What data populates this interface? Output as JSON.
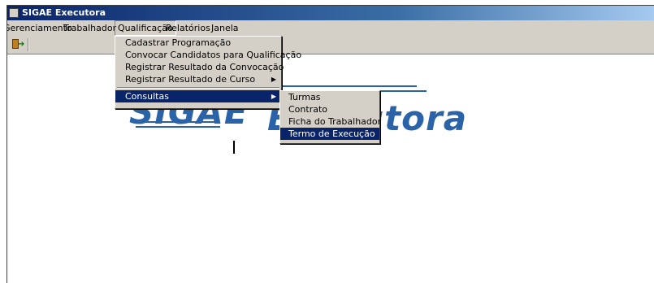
{
  "window": {
    "title": "SIGAE Executora"
  },
  "menubar": {
    "items": [
      {
        "label": "Gerenciamento"
      },
      {
        "label": "Trabalhador"
      },
      {
        "label": "Qualificação"
      },
      {
        "label": "Relatórios"
      },
      {
        "label": "Janela"
      }
    ]
  },
  "qualificacao_menu": {
    "items": [
      {
        "label": "Cadastrar Programação"
      },
      {
        "label": "Convocar Candidatos para Qualificação"
      },
      {
        "label": "Registrar Resultado da Convocação"
      },
      {
        "label": "Registrar Resultado de Curso",
        "arrow": "▶"
      },
      {
        "label": "Consultas",
        "arrow": "▶"
      }
    ]
  },
  "consultas_menu": {
    "items": [
      {
        "label": "Turmas"
      },
      {
        "label": "Contrato"
      },
      {
        "label": "Ficha do Trabalhador"
      },
      {
        "label": "Termo de Execução"
      }
    ]
  },
  "logo": {
    "left_fragment": "SIGAE",
    "right_fragment": "Executora"
  },
  "colors": {
    "title_gradient_start": "#0a246a",
    "menu_highlight": "#0a246a",
    "logo_blue": "#2a63a8",
    "chrome": "#d4d0c8"
  },
  "icons": {
    "window_icon": "app-icon",
    "exit": "exit-door-icon"
  }
}
